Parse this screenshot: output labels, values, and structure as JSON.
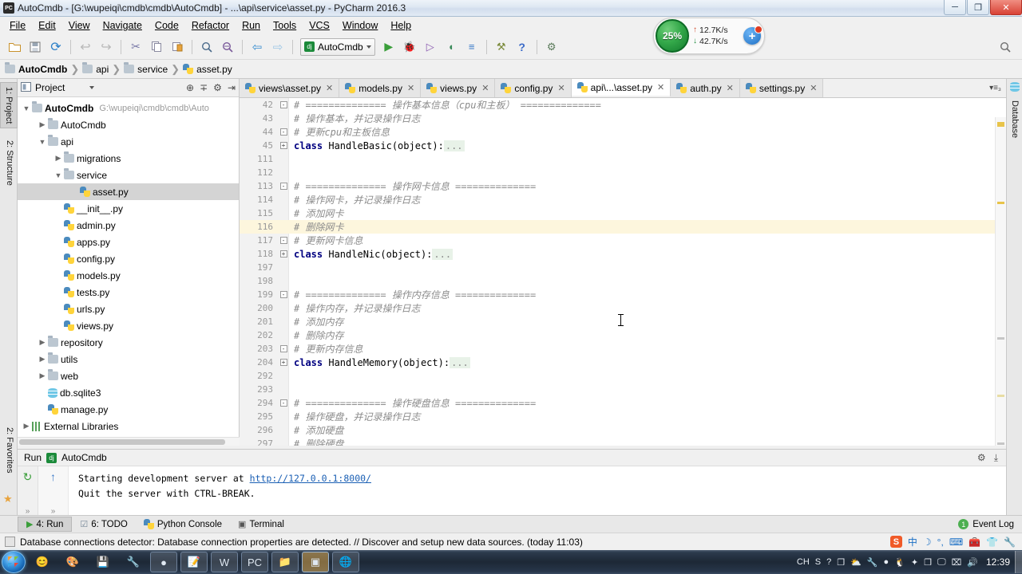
{
  "window": {
    "title": "AutoCmdb - [G:\\wupeiqi\\cmdb\\cmdb\\AutoCmdb] - ...\\api\\service\\asset.py - PyCharm 2016.3",
    "app_icon": "PC",
    "minimize": "─",
    "maximize": "❐",
    "close": "✕"
  },
  "menu": [
    {
      "label": "File"
    },
    {
      "label": "Edit"
    },
    {
      "label": "View"
    },
    {
      "label": "Navigate"
    },
    {
      "label": "Code"
    },
    {
      "label": "Refactor"
    },
    {
      "label": "Run"
    },
    {
      "label": "Tools"
    },
    {
      "label": "VCS"
    },
    {
      "label": "Window"
    },
    {
      "label": "Help"
    }
  ],
  "toolbar": {
    "icons": [
      {
        "name": "open-folder-icon",
        "glyph": "📁"
      },
      {
        "name": "save-all-icon",
        "glyph": "💾"
      },
      {
        "name": "sync-icon",
        "glyph": "⟳"
      },
      {
        "name": "undo-icon",
        "glyph": "↩"
      },
      {
        "name": "redo-icon",
        "glyph": "↪"
      },
      {
        "name": "cut-icon",
        "glyph": "✂"
      },
      {
        "name": "copy-icon",
        "glyph": "❐"
      },
      {
        "name": "paste-icon",
        "glyph": "📋"
      },
      {
        "name": "find-icon",
        "glyph": "🔍"
      },
      {
        "name": "replace-icon",
        "glyph": "🔎"
      },
      {
        "name": "back-icon",
        "glyph": "⇦"
      },
      {
        "name": "forward-icon",
        "glyph": "⇨"
      }
    ],
    "run_config_name": "AutoCmdb",
    "run_config_icon": "dj",
    "action_icons": [
      {
        "name": "run-icon",
        "glyph": "▶"
      },
      {
        "name": "debug-icon",
        "glyph": "🐞"
      },
      {
        "name": "coverage-icon",
        "glyph": "▷"
      },
      {
        "name": "profile-icon",
        "glyph": "▶"
      },
      {
        "name": "run-with-console-icon",
        "glyph": "≡"
      },
      {
        "name": "attach-icon",
        "glyph": "⚒"
      },
      {
        "name": "help-icon",
        "glyph": "?"
      },
      {
        "name": "settings-gear-icon",
        "glyph": "⚙"
      }
    ],
    "search_everywhere_icon": "🔍"
  },
  "net_widget": {
    "percent": "25%",
    "upload": "12.7K/s",
    "download": "42.7K/s",
    "upload_arrow": "↑",
    "download_arrow": "↓",
    "plus": "+"
  },
  "breadcrumb": [
    {
      "label": "AutoCmdb",
      "icon": "folder-icon"
    },
    {
      "label": "api",
      "icon": "folder-icon"
    },
    {
      "label": "service",
      "icon": "folder-icon"
    },
    {
      "label": "asset.py",
      "icon": "python-file-icon"
    }
  ],
  "left_strip": [
    {
      "label": "1: Project",
      "active": true
    },
    {
      "label": "2: Structure",
      "active": false
    }
  ],
  "left_strip_bottom": [
    {
      "label": "2: Favorites"
    }
  ],
  "right_strip": [
    {
      "label": "Database"
    }
  ],
  "project_panel": {
    "title": "Project",
    "header_icons": [
      "target-icon",
      "collapse-all-icon",
      "settings-icon",
      "hide-icon"
    ],
    "tree": [
      {
        "indent": 0,
        "twisty": "▼",
        "icon": "folder-icon",
        "label": "AutoCmdb",
        "bold": true,
        "path": "G:\\wupeiqi\\cmdb\\cmdb\\Auto",
        "selected": false
      },
      {
        "indent": 1,
        "twisty": "▶",
        "icon": "folder-icon",
        "label": "AutoCmdb",
        "bold": false,
        "path": "",
        "selected": false
      },
      {
        "indent": 1,
        "twisty": "▼",
        "icon": "folder-icon",
        "label": "api",
        "bold": false,
        "path": "",
        "selected": false
      },
      {
        "indent": 2,
        "twisty": "▶",
        "icon": "folder-icon",
        "label": "migrations",
        "bold": false,
        "path": "",
        "selected": false
      },
      {
        "indent": 2,
        "twisty": "▼",
        "icon": "folder-icon",
        "label": "service",
        "bold": false,
        "path": "",
        "selected": false
      },
      {
        "indent": 3,
        "twisty": "",
        "icon": "python-file-icon",
        "label": "asset.py",
        "bold": false,
        "path": "",
        "selected": true
      },
      {
        "indent": 2,
        "twisty": "",
        "icon": "python-file-icon",
        "label": "__init__.py",
        "bold": false,
        "path": "",
        "selected": false
      },
      {
        "indent": 2,
        "twisty": "",
        "icon": "python-file-icon",
        "label": "admin.py",
        "bold": false,
        "path": "",
        "selected": false
      },
      {
        "indent": 2,
        "twisty": "",
        "icon": "python-file-icon",
        "label": "apps.py",
        "bold": false,
        "path": "",
        "selected": false
      },
      {
        "indent": 2,
        "twisty": "",
        "icon": "python-file-icon",
        "label": "config.py",
        "bold": false,
        "path": "",
        "selected": false
      },
      {
        "indent": 2,
        "twisty": "",
        "icon": "python-file-icon",
        "label": "models.py",
        "bold": false,
        "path": "",
        "selected": false
      },
      {
        "indent": 2,
        "twisty": "",
        "icon": "python-file-icon",
        "label": "tests.py",
        "bold": false,
        "path": "",
        "selected": false
      },
      {
        "indent": 2,
        "twisty": "",
        "icon": "python-file-icon",
        "label": "urls.py",
        "bold": false,
        "path": "",
        "selected": false
      },
      {
        "indent": 2,
        "twisty": "",
        "icon": "python-file-icon",
        "label": "views.py",
        "bold": false,
        "path": "",
        "selected": false
      },
      {
        "indent": 1,
        "twisty": "▶",
        "icon": "folder-icon",
        "label": "repository",
        "bold": false,
        "path": "",
        "selected": false
      },
      {
        "indent": 1,
        "twisty": "▶",
        "icon": "folder-icon",
        "label": "utils",
        "bold": false,
        "path": "",
        "selected": false
      },
      {
        "indent": 1,
        "twisty": "▶",
        "icon": "folder-icon",
        "label": "web",
        "bold": false,
        "path": "",
        "selected": false
      },
      {
        "indent": 1,
        "twisty": "",
        "icon": "database-icon",
        "label": "db.sqlite3",
        "bold": false,
        "path": "",
        "selected": false
      },
      {
        "indent": 1,
        "twisty": "",
        "icon": "python-file-icon",
        "label": "manage.py",
        "bold": false,
        "path": "",
        "selected": false
      },
      {
        "indent": 0,
        "twisty": "▶",
        "icon": "library-icon",
        "label": "External Libraries",
        "bold": false,
        "path": "",
        "selected": false
      }
    ]
  },
  "editor": {
    "tabs": [
      {
        "label": "views\\asset.py",
        "active": false
      },
      {
        "label": "models.py",
        "active": false
      },
      {
        "label": "views.py",
        "active": false
      },
      {
        "label": "config.py",
        "active": false
      },
      {
        "label": "api\\...\\asset.py",
        "active": true
      },
      {
        "label": "auth.py",
        "active": false
      },
      {
        "label": "settings.py",
        "active": false
      }
    ],
    "tab_close": "✕",
    "tab_overflow": "▾≡₃",
    "lines": [
      {
        "num": "42",
        "fold": "-",
        "text": "# ============== 操作基本信息（cpu和主板） ==============",
        "type": "comment",
        "hl": false
      },
      {
        "num": "43",
        "fold": "",
        "text": "# 操作基本，并记录操作日志",
        "type": "comment",
        "hl": false
      },
      {
        "num": "44",
        "fold": "-",
        "text": "# 更新cpu和主板信息",
        "type": "comment",
        "hl": false
      },
      {
        "num": "45",
        "fold": "+",
        "text": "class HandleBasic(object):...",
        "type": "class",
        "hl": false
      },
      {
        "num": "111",
        "fold": "",
        "text": "",
        "type": "blank",
        "hl": false
      },
      {
        "num": "112",
        "fold": "",
        "text": "",
        "type": "blank",
        "hl": false
      },
      {
        "num": "113",
        "fold": "-",
        "text": "# ============== 操作网卡信息 ==============",
        "type": "comment",
        "hl": false
      },
      {
        "num": "114",
        "fold": "",
        "text": "# 操作网卡，并记录操作日志",
        "type": "comment",
        "hl": false
      },
      {
        "num": "115",
        "fold": "",
        "text": "# 添加网卡",
        "type": "comment",
        "hl": false
      },
      {
        "num": "116",
        "fold": "",
        "text": "# 删除网卡",
        "type": "comment",
        "hl": true
      },
      {
        "num": "117",
        "fold": "-",
        "text": "# 更新网卡信息",
        "type": "comment",
        "hl": false
      },
      {
        "num": "118",
        "fold": "+",
        "text": "class HandleNic(object):...",
        "type": "class",
        "hl": false
      },
      {
        "num": "197",
        "fold": "",
        "text": "",
        "type": "blank",
        "hl": false
      },
      {
        "num": "198",
        "fold": "",
        "text": "",
        "type": "blank",
        "hl": false
      },
      {
        "num": "199",
        "fold": "-",
        "text": "# ============== 操作内存信息 ==============",
        "type": "comment",
        "hl": false
      },
      {
        "num": "200",
        "fold": "",
        "text": "# 操作内存，并记录操作日志",
        "type": "comment",
        "hl": false
      },
      {
        "num": "201",
        "fold": "",
        "text": "# 添加内存",
        "type": "comment",
        "hl": false
      },
      {
        "num": "202",
        "fold": "",
        "text": "# 删除内存",
        "type": "comment",
        "hl": false
      },
      {
        "num": "203",
        "fold": "-",
        "text": "# 更新内存信息",
        "type": "comment",
        "hl": false
      },
      {
        "num": "204",
        "fold": "+",
        "text": "class HandleMemory(object):...",
        "type": "class",
        "hl": false
      },
      {
        "num": "292",
        "fold": "",
        "text": "",
        "type": "blank",
        "hl": false
      },
      {
        "num": "293",
        "fold": "",
        "text": "",
        "type": "blank",
        "hl": false
      },
      {
        "num": "294",
        "fold": "-",
        "text": "# ============== 操作硬盘信息 ==============",
        "type": "comment",
        "hl": false
      },
      {
        "num": "295",
        "fold": "",
        "text": "# 操作硬盘，并记录操作日志",
        "type": "comment",
        "hl": false
      },
      {
        "num": "296",
        "fold": "",
        "text": "# 添加硬盘",
        "type": "comment",
        "hl": false
      },
      {
        "num": "297",
        "fold": "",
        "text": "# 删除硬盘",
        "type": "comment",
        "hl": false
      }
    ],
    "class_keyword": "class",
    "fold_ellipsis": "..."
  },
  "run_window": {
    "title_run": "Run",
    "title_config": "AutoCmdb",
    "config_icon": "dj",
    "console_lines": [
      {
        "prefix": "Starting development server at ",
        "link": "http://127.0.0.1:8000/",
        "suffix": ""
      },
      {
        "prefix": "Quit the server with CTRL-BREAK.",
        "link": "",
        "suffix": ""
      }
    ],
    "sidebar_icons": [
      {
        "name": "rerun-icon",
        "glyph": "↻"
      },
      {
        "name": "scroll-up-icon",
        "glyph": "↑"
      }
    ],
    "expand_glyph": "»",
    "header_icons": [
      {
        "name": "settings-gear-icon",
        "glyph": "⚙"
      },
      {
        "name": "hide-icon",
        "glyph": "⤓"
      }
    ]
  },
  "tool_window_bar": {
    "buttons": [
      {
        "label": "4: Run",
        "icon": "run-icon",
        "active": true
      },
      {
        "label": "6: TODO",
        "icon": "todo-icon",
        "active": false
      },
      {
        "label": "Python Console",
        "icon": "python-icon",
        "active": false
      },
      {
        "label": "Terminal",
        "icon": "terminal-icon",
        "active": false
      }
    ],
    "event_log_label": "Event Log",
    "event_log_count": "1"
  },
  "status_bar": {
    "message": "Database connections detector: Database connection properties are detected. // Discover and setup new data sources. (today 11:03)",
    "ime_icons": [
      {
        "name": "sogou-icon",
        "glyph": "S"
      },
      {
        "name": "chinese-mode-icon",
        "glyph": "中"
      },
      {
        "name": "moon-icon",
        "glyph": "☽"
      },
      {
        "name": "punctuation-icon",
        "glyph": "°,"
      },
      {
        "name": "keyboard-icon",
        "glyph": "⌨"
      },
      {
        "name": "toolbox-icon",
        "glyph": "🧰"
      },
      {
        "name": "skin-icon",
        "glyph": "👕"
      },
      {
        "name": "wrench-icon",
        "glyph": "🔧"
      }
    ]
  },
  "taskbar": {
    "start_label": "Start",
    "apps": [
      {
        "name": "taskbar-icon-emoji",
        "glyph": "😊",
        "boxed": false,
        "active": false
      },
      {
        "name": "taskbar-icon-paint",
        "glyph": "🎨",
        "boxed": false,
        "active": false
      },
      {
        "name": "taskbar-icon-save",
        "glyph": "💾",
        "boxed": false,
        "active": false
      },
      {
        "name": "taskbar-icon-tools",
        "glyph": "🔧",
        "boxed": false,
        "active": false
      },
      {
        "name": "taskbar-icon-chrome",
        "glyph": "●",
        "boxed": true,
        "active": false
      },
      {
        "name": "taskbar-icon-notepad",
        "glyph": "📝",
        "boxed": true,
        "active": false
      },
      {
        "name": "taskbar-icon-word",
        "glyph": "W",
        "boxed": true,
        "active": false
      },
      {
        "name": "taskbar-icon-pycharm",
        "glyph": "PC",
        "boxed": true,
        "active": false
      },
      {
        "name": "taskbar-icon-explorer",
        "glyph": "📁",
        "boxed": true,
        "active": false
      },
      {
        "name": "taskbar-icon-app-orange",
        "glyph": "▣",
        "boxed": true,
        "active": true
      },
      {
        "name": "taskbar-icon-media",
        "glyph": "🌐",
        "boxed": true,
        "active": false
      }
    ],
    "tray": [
      {
        "name": "language-indicator",
        "glyph": "CH"
      },
      {
        "name": "sogou-tray-icon",
        "glyph": "S"
      },
      {
        "name": "help-tray-icon",
        "glyph": "?"
      },
      {
        "name": "window-tray-icon",
        "glyph": "❐"
      },
      {
        "name": "weather-tray-icon",
        "glyph": "⛅"
      },
      {
        "name": "tools-tray-icon",
        "glyph": "🔧"
      },
      {
        "name": "record-tray-icon",
        "glyph": "●"
      },
      {
        "name": "qq-tray-icon",
        "glyph": "🐧"
      },
      {
        "name": "security-tray-icon",
        "glyph": "✦"
      },
      {
        "name": "copy-tray-icon",
        "glyph": "❐"
      },
      {
        "name": "monitor-tray-icon",
        "glyph": "🖵"
      },
      {
        "name": "excel-tray-icon",
        "glyph": "⌧"
      },
      {
        "name": "volume-tray-icon",
        "glyph": "🔊"
      }
    ],
    "clock": "12:39"
  }
}
